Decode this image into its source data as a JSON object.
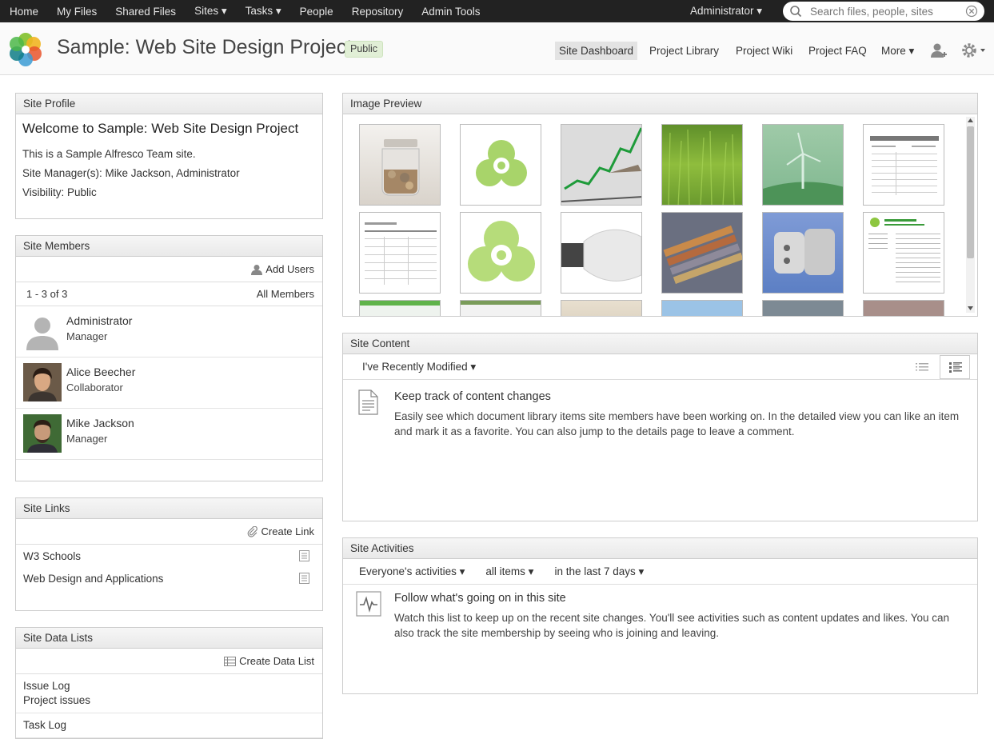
{
  "topbar": {
    "items": [
      "Home",
      "My Files",
      "Shared Files",
      "Sites ▾",
      "Tasks ▾",
      "People",
      "Repository",
      "Admin Tools"
    ],
    "user_menu": "Administrator ▾",
    "search_placeholder": "Search files, people, sites"
  },
  "header": {
    "title": "Sample: Web Site Design Project",
    "visibility_badge": "Public",
    "nav": [
      "Site Dashboard",
      "Project Library",
      "Project Wiki",
      "Project FAQ",
      "More ▾"
    ]
  },
  "site_profile": {
    "title": "Site Profile",
    "welcome": "Welcome to Sample: Web Site Design Project",
    "description": "This is a Sample Alfresco Team site.",
    "managers": "Site Manager(s): Mike Jackson, Administrator",
    "visibility": "Visibility: Public"
  },
  "site_members": {
    "title": "Site Members",
    "add_users": "Add Users",
    "count": "1 - 3 of 3",
    "all_members": "All Members",
    "members": [
      {
        "name": "Administrator",
        "role": "Manager"
      },
      {
        "name": "Alice Beecher",
        "role": "Collaborator"
      },
      {
        "name": "Mike Jackson",
        "role": "Manager"
      }
    ]
  },
  "site_links": {
    "title": "Site Links",
    "create": "Create Link",
    "links": [
      "W3 Schools",
      "Web Design and Applications"
    ]
  },
  "site_data_lists": {
    "title": "Site Data Lists",
    "create": "Create Data List",
    "lists": [
      {
        "name": "Issue Log",
        "desc": "Project issues"
      },
      {
        "name": "Task Log",
        "desc": ""
      }
    ]
  },
  "image_preview": {
    "title": "Image Preview"
  },
  "site_content": {
    "title": "Site Content",
    "filter": "I've Recently Modified ▾",
    "heading": "Keep track of content changes",
    "body": "Easily see which document library items site members have been working on. In the detailed view you can like an item and mark it as a favorite. You can also jump to the details page to leave a comment."
  },
  "site_activities": {
    "title": "Site Activities",
    "filters": [
      "Everyone's activities ▾",
      "all items ▾",
      "in the last 7 days ▾"
    ],
    "heading": "Follow what's going on in this site",
    "body": "Watch this list to keep up on the recent site changes. You'll see activities such as content updates and likes. You can also track the site membership by seeing who is joining and leaving."
  },
  "colors": {
    "topbar_bg": "#222222",
    "badge_bg": "#e1efd6",
    "brand_green": "#8dc63f"
  }
}
